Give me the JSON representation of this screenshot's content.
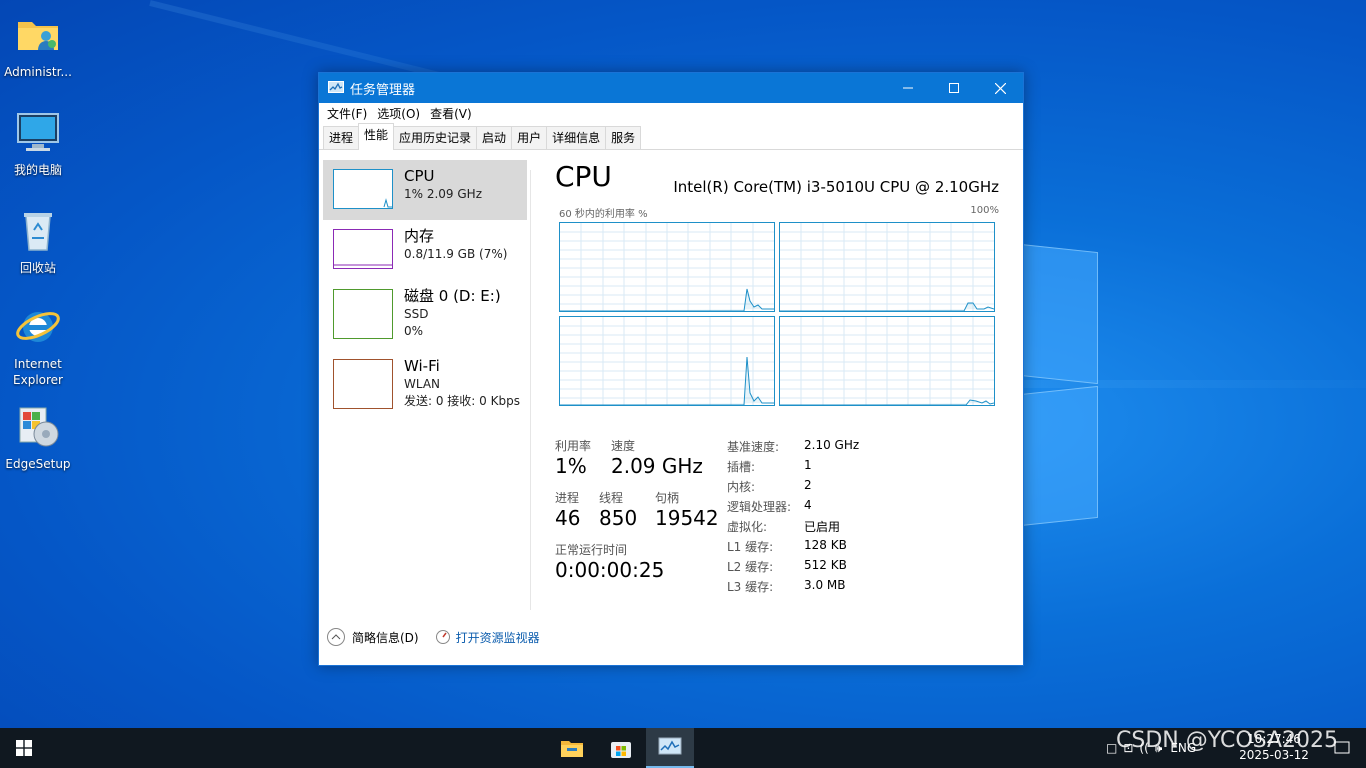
{
  "desktop": {
    "icons": [
      {
        "label": "Administr..."
      },
      {
        "label": "我的电脑"
      },
      {
        "label": "回收站"
      },
      {
        "label": "Internet Explorer"
      },
      {
        "label": "EdgeSetup"
      }
    ]
  },
  "window": {
    "title": "任务管理器",
    "menu": [
      "文件(F)",
      "选项(O)",
      "查看(V)"
    ],
    "tabs": [
      "进程",
      "性能",
      "应用历史记录",
      "启动",
      "用户",
      "详细信息",
      "服务"
    ],
    "active_tab": "性能",
    "sidebar": [
      {
        "name": "CPU",
        "line1": "1% 2.09 GHz",
        "line2": "",
        "color": "#1e90c8",
        "selected": true
      },
      {
        "name": "内存",
        "line1": "0.8/11.9 GB (7%)",
        "line2": "",
        "color": "#8b2ab5",
        "selected": false
      },
      {
        "name": "磁盘 0 (D: E:)",
        "line1": "SSD",
        "line2": "0%",
        "color": "#4f9a2d",
        "selected": false
      },
      {
        "name": "Wi-Fi",
        "line1": "WLAN",
        "line2": "发送: 0 接收: 0 Kbps",
        "color": "#a0522d",
        "selected": false
      }
    ],
    "main": {
      "heading": "CPU",
      "model": "Intel(R) Core(TM) i3-5010U CPU @ 2.10GHz",
      "graph_label_left": "60 秒内的利用率 %",
      "graph_label_right": "100%",
      "stats": {
        "util_label": "利用率",
        "util_value": "1%",
        "speed_label": "速度",
        "speed_value": "2.09 GHz",
        "proc_label": "进程",
        "proc_value": "46",
        "thread_label": "线程",
        "thread_value": "850",
        "handle_label": "句柄",
        "handle_value": "19542",
        "uptime_label": "正常运行时间",
        "uptime_value": "0:00:00:25"
      },
      "details": [
        {
          "k": "基准速度:",
          "v": "2.10 GHz"
        },
        {
          "k": "插槽:",
          "v": "1"
        },
        {
          "k": "内核:",
          "v": "2"
        },
        {
          "k": "逻辑处理器:",
          "v": "4"
        },
        {
          "k": "虚拟化:",
          "v": "已启用"
        },
        {
          "k": "L1 缓存:",
          "v": "128 KB"
        },
        {
          "k": "L2 缓存:",
          "v": "512 KB"
        },
        {
          "k": "L3 缓存:",
          "v": "3.0 MB"
        }
      ]
    },
    "footer": {
      "fewer_details": "简略信息(D)",
      "resource_monitor": "打开资源监视器"
    }
  },
  "taskbar": {
    "tray_lang": "ENG",
    "clock_time": "10:27:46",
    "clock_date": "2025-03-12",
    "watermark": "CSDN @YCOSA2025"
  },
  "colors": {
    "accent": "#0a76d6",
    "cpu_graph": "#1e90c8"
  }
}
